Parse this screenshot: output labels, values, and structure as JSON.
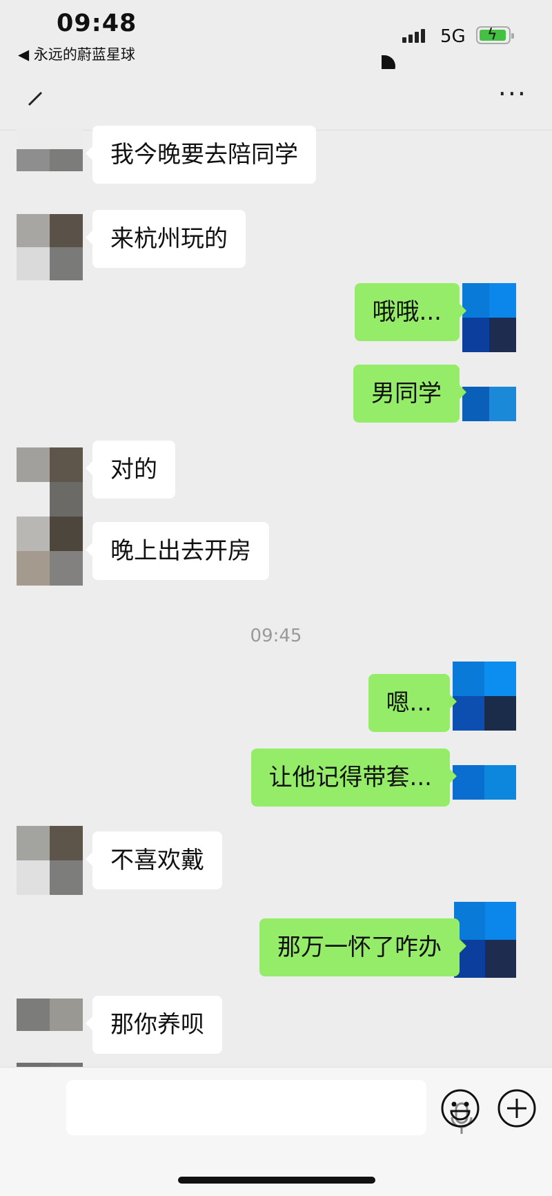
{
  "status_bar": {
    "time": "09:48",
    "back_app": "◀ 永远的蔚蓝星球",
    "network": "5G",
    "battery": "charging"
  },
  "nav": {
    "back_icon": "chevron-left-icon",
    "more_label": "···"
  },
  "colors": {
    "background": "#ededed",
    "incoming_bubble": "#ffffff",
    "outgoing_bubble": "#95ec69",
    "timestamp": "#999999"
  },
  "messages": [
    {
      "side": "in",
      "text": "我今晚要去陪同学"
    },
    {
      "side": "in",
      "text": "来杭州玩的"
    },
    {
      "side": "out",
      "text": "哦哦..."
    },
    {
      "side": "out",
      "text": "男同学"
    },
    {
      "side": "in",
      "text": "对的"
    },
    {
      "side": "in",
      "text": "晚上出去开房"
    },
    {
      "side": "time",
      "text": "09:45"
    },
    {
      "side": "out",
      "text": "嗯..."
    },
    {
      "side": "out",
      "text": "让他记得带套..."
    },
    {
      "side": "in",
      "text": "不喜欢戴"
    },
    {
      "side": "out",
      "text": "那万一怀了咋办"
    },
    {
      "side": "in",
      "text": "那你养呗"
    }
  ],
  "input_bar": {
    "placeholder": "",
    "mic_icon": "microphone-icon",
    "emoji_icon": "emoji-icon",
    "plus_icon": "plus-circle-icon"
  }
}
